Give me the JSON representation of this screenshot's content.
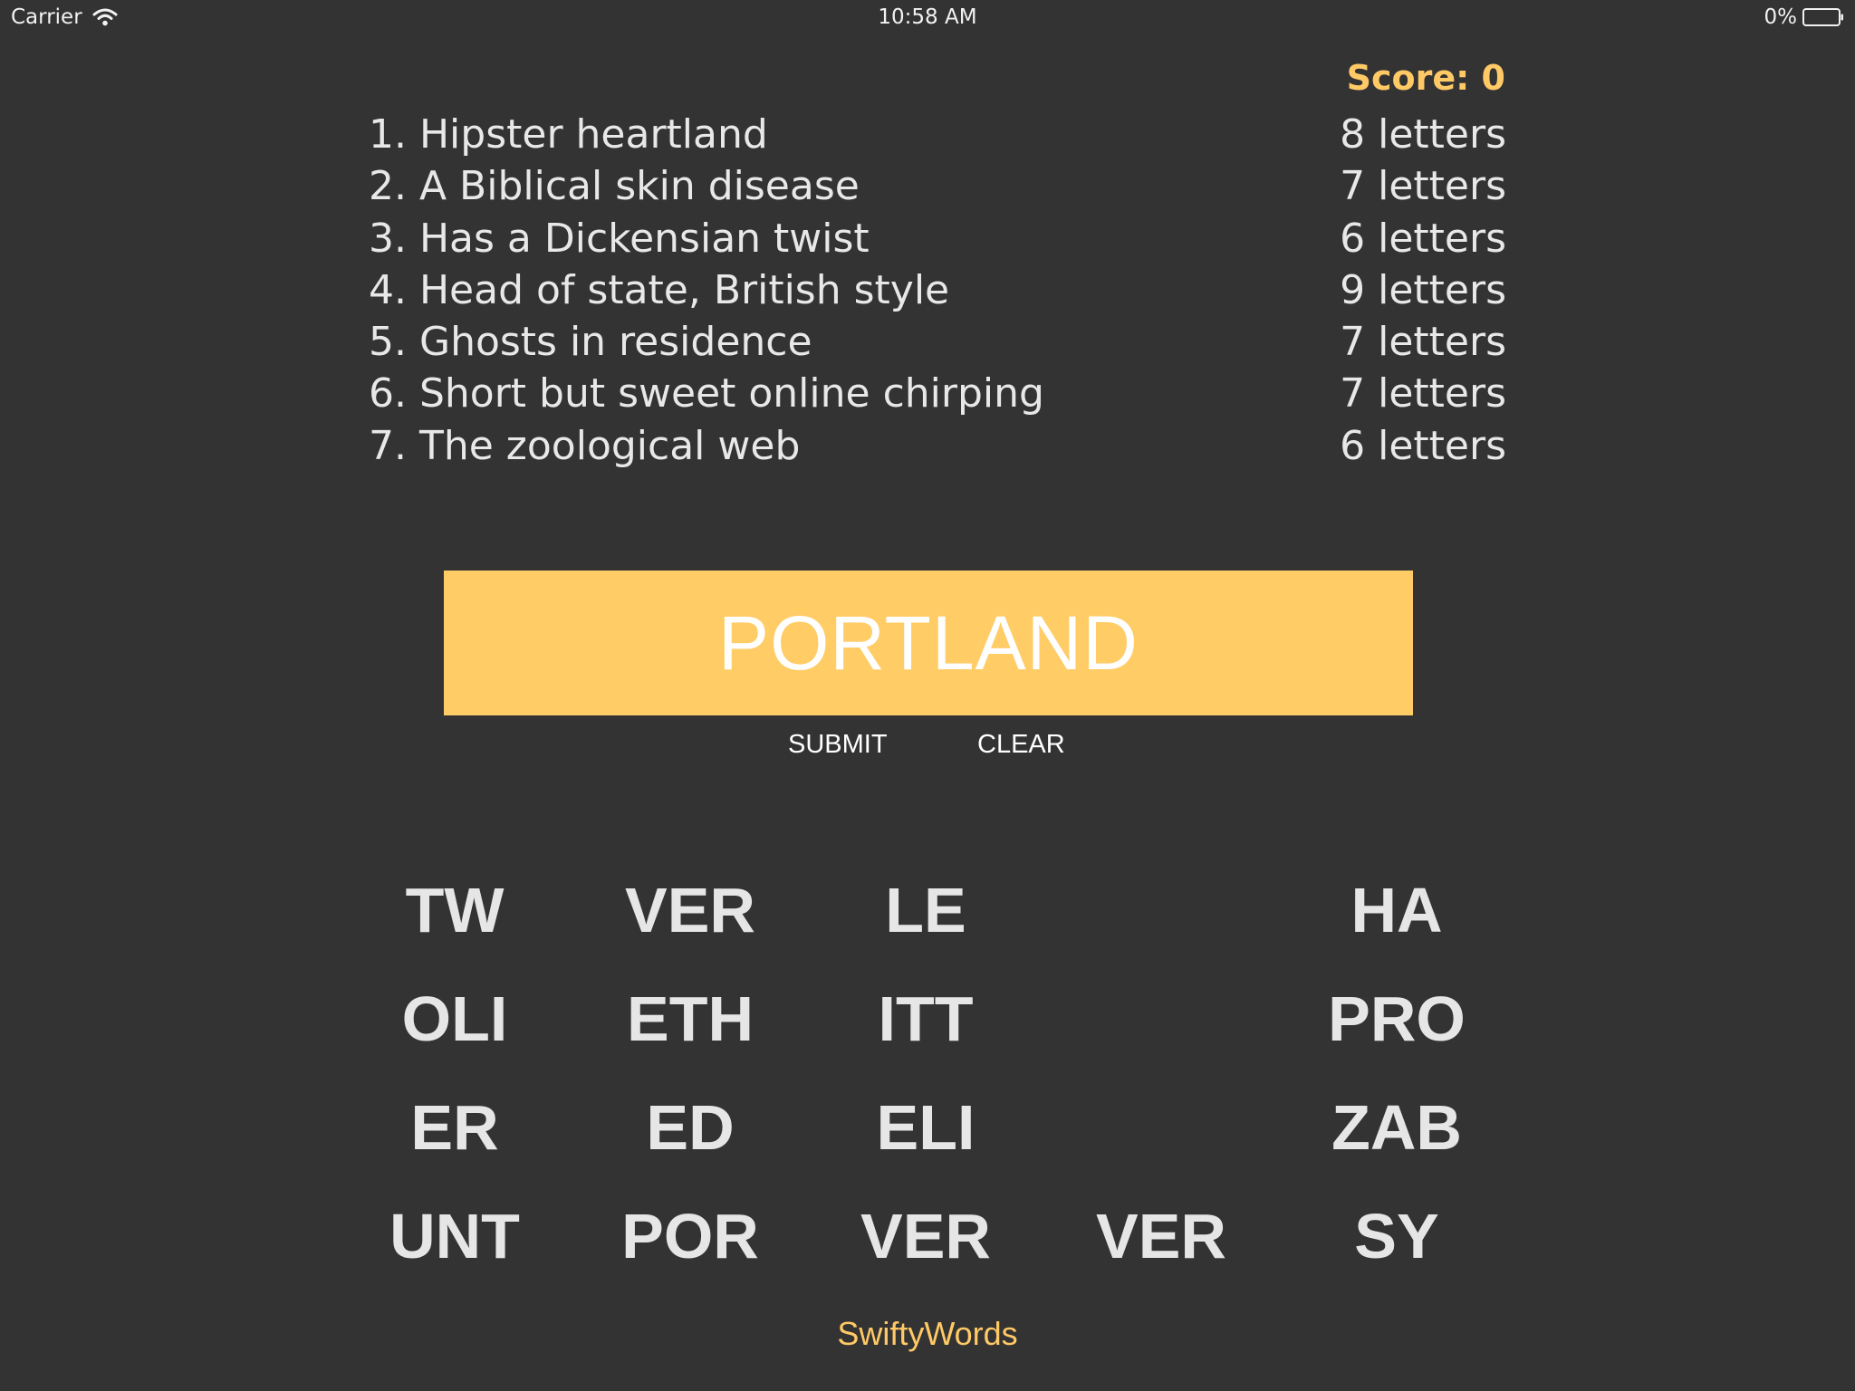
{
  "status_bar": {
    "carrier": "Carrier",
    "time": "10:58 AM",
    "battery": "0%"
  },
  "score": "Score: 0",
  "clues": [
    {
      "clue": "1. Hipster heartland",
      "length": "8 letters"
    },
    {
      "clue": "2. A Biblical skin disease",
      "length": "7 letters"
    },
    {
      "clue": "3. Has a Dickensian twist",
      "length": "6 letters"
    },
    {
      "clue": "4. Head of state, British style",
      "length": "9 letters"
    },
    {
      "clue": "5. Ghosts in residence",
      "length": "7 letters"
    },
    {
      "clue": "6. Short but sweet online chirping",
      "length": "7 letters"
    },
    {
      "clue": "7. The zoological web",
      "length": "6 letters"
    }
  ],
  "answer": "PORTLAND",
  "buttons": {
    "submit": "SUBMIT",
    "clear": "CLEAR"
  },
  "letter_buttons": [
    "TW",
    "VER",
    "LE",
    "",
    "HA",
    "OLI",
    "ETH",
    "ITT",
    "",
    "PRO",
    "ER",
    "ED",
    "ELI",
    "",
    "ZAB",
    "UNT",
    "POR",
    "VER",
    "VER",
    "SY"
  ],
  "footer": "SwiftyWords",
  "colors": {
    "background": "#333333",
    "accent": "#ffcc66",
    "text": "#e6e6e6"
  }
}
